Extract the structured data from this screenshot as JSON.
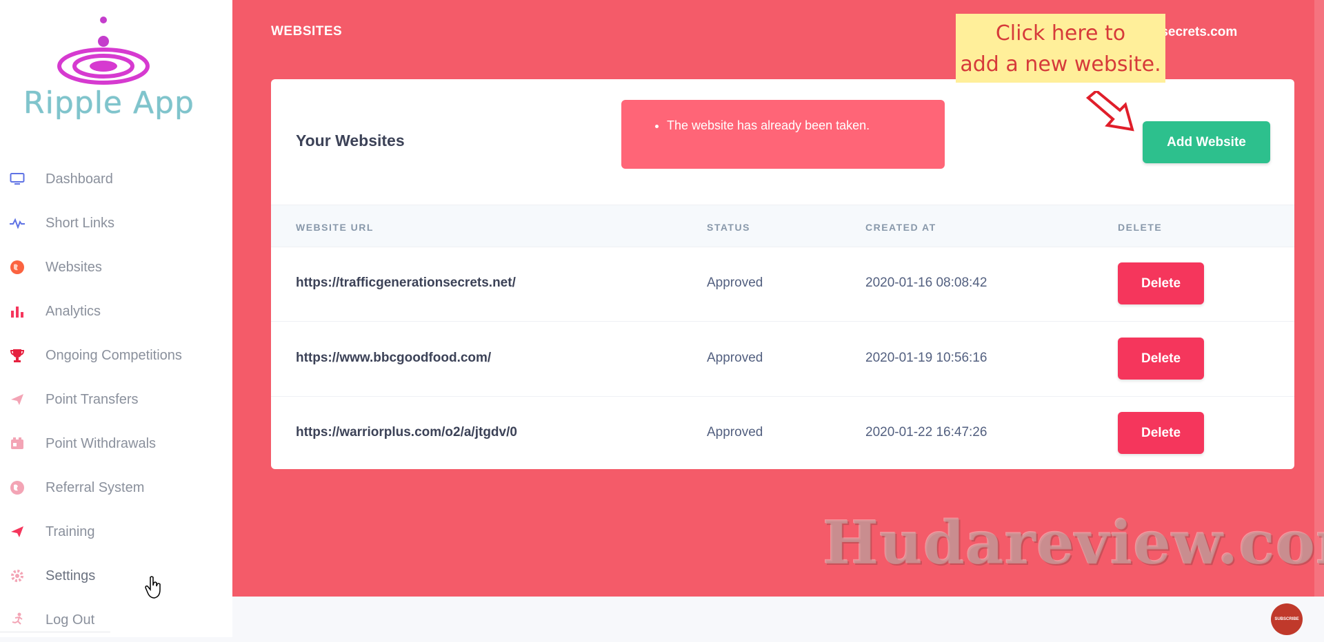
{
  "app": {
    "logo_text": "Ripple App",
    "brand_colors": {
      "logo_text": "#7fc4cc",
      "logo_icon": "#d63ad0"
    }
  },
  "sidebar": {
    "items": [
      {
        "label": "Dashboard",
        "icon": "monitor-icon"
      },
      {
        "label": "Short Links",
        "icon": "pulse-icon"
      },
      {
        "label": "Websites",
        "icon": "globe-icon"
      },
      {
        "label": "Analytics",
        "icon": "bar-chart-icon"
      },
      {
        "label": "Ongoing Competitions",
        "icon": "trophy-icon"
      },
      {
        "label": "Point Transfers",
        "icon": "paper-plane-icon"
      },
      {
        "label": "Point Withdrawals",
        "icon": "id-card-icon"
      },
      {
        "label": "Referral System",
        "icon": "globe-icon"
      },
      {
        "label": "Training",
        "icon": "paper-plane-icon"
      },
      {
        "label": "Settings",
        "icon": "gear-icon"
      },
      {
        "label": "Log Out",
        "icon": "running-icon"
      }
    ]
  },
  "header": {
    "title": "WEBSITES",
    "user_email": "erationsecrets.com"
  },
  "callout": {
    "line1": "Click here to",
    "line2": "add a new website."
  },
  "card": {
    "title": "Your Websites",
    "alert_message": "The website has already been taken.",
    "add_button_label": "Add Website"
  },
  "table": {
    "columns": [
      "WEBSITE URL",
      "STATUS",
      "CREATED AT",
      "DELETE"
    ],
    "rows": [
      {
        "url": "https://trafficgenerationsecrets.net/",
        "status": "Approved",
        "created_at": "2020-01-16 08:08:42",
        "action": "Delete"
      },
      {
        "url": "https://www.bbcgoodfood.com/",
        "status": "Approved",
        "created_at": "2020-01-19 10:56:16",
        "action": "Delete"
      },
      {
        "url": "https://warriorplus.com/o2/a/jtgdv/0",
        "status": "Approved",
        "created_at": "2020-01-22 16:47:26",
        "action": "Delete"
      }
    ]
  },
  "watermark": "Hudareview.com",
  "subscribe_badge": "SUBSCRIBE",
  "colors": {
    "main_bg": "#f45b69",
    "add_button": "#2dc08d",
    "delete_button": "#f5365c",
    "alert_bg": "#ff6577",
    "callout_bg": "#ffef9a",
    "callout_text": "#d63a3a"
  }
}
